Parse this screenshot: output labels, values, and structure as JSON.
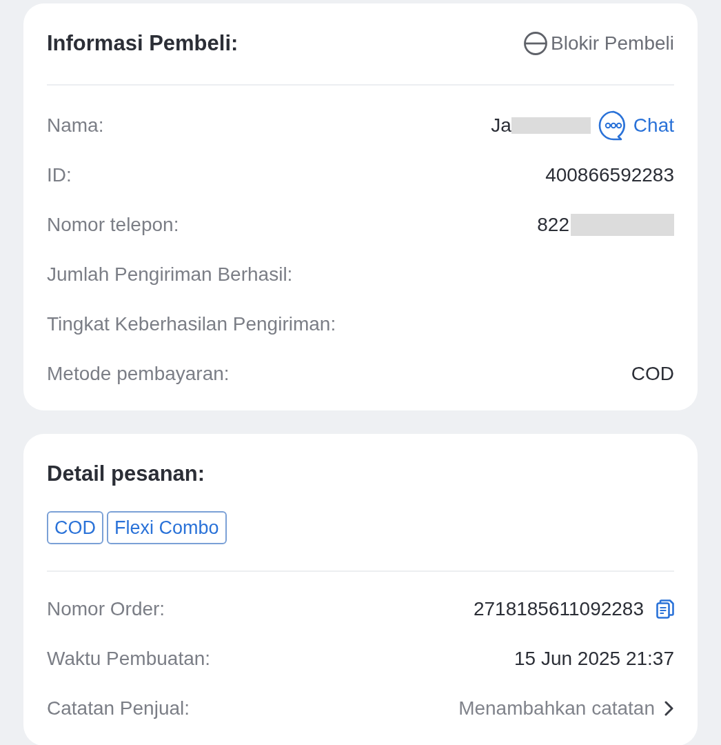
{
  "buyer_info": {
    "title": "Informasi Pembeli:",
    "block_action": "Blokir Pembeli",
    "rows": [
      {
        "label": "Nama:",
        "value": "Ja",
        "masked": true,
        "chat": "Chat"
      },
      {
        "label": "ID:",
        "value": "400866592283"
      },
      {
        "label": "Nomor telepon:",
        "value": "822",
        "masked": true
      },
      {
        "label": "Jumlah Pengiriman Berhasil:"
      },
      {
        "label": "Tingkat Keberhasilan Pengiriman:"
      },
      {
        "label": "Metode pembayaran:",
        "value": "COD"
      }
    ]
  },
  "order_details": {
    "title": "Detail pesanan:",
    "tags": [
      "COD",
      "Flexi Combo"
    ],
    "rows": [
      {
        "label": "Nomor Order:",
        "value": "2718185611092283",
        "copyable": true
      },
      {
        "label": "Waktu Pembuatan:",
        "value": "15 Jun 2025 21:37"
      },
      {
        "label": "Catatan Penjual:",
        "value": "Menambahkan catatan",
        "kind": "link"
      }
    ]
  }
}
